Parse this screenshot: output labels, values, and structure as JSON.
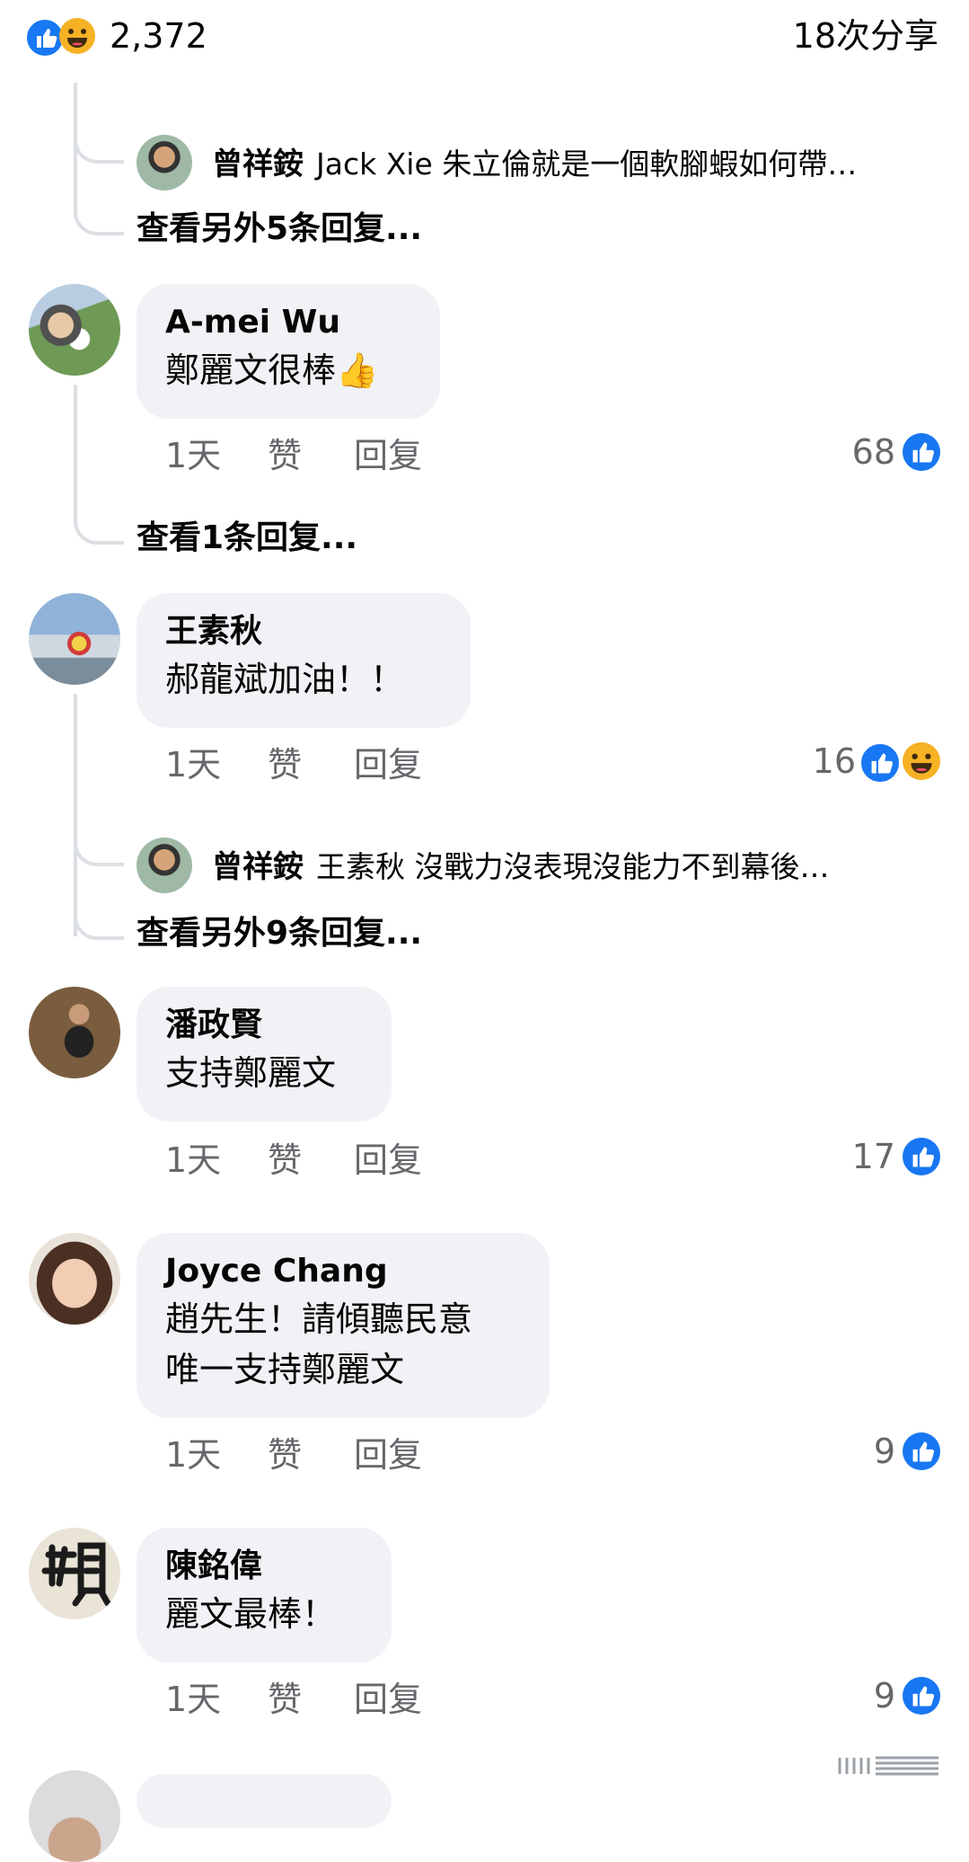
{
  "header": {
    "reaction_count": "2,372",
    "shares": "18次分享"
  },
  "colors": {
    "like_blue": "#1877f2",
    "haha_yellow": "#f7b125",
    "bubble_bg": "#f0f2f5",
    "meta_gray": "#65676b"
  },
  "thread0": {
    "reply_author": "曾祥銨",
    "reply_text": "Jack Xie 朱立倫就是一個軟腳蝦如何帶…",
    "more": "查看另外5条回复..."
  },
  "comments": [
    {
      "author": "A-mei Wu",
      "text": "鄭麗文很棒👍",
      "time": "1天",
      "like": "赞",
      "reply": "回复",
      "count": "68",
      "more": "查看1条回复..."
    },
    {
      "author": "王素秋",
      "text": "郝龍斌加油！！",
      "time": "1天",
      "like": "赞",
      "reply": "回复",
      "count": "16",
      "reply_author": "曾祥銨",
      "reply_text": "王素秋 沒戰力沒表現沒能力￼不到幕後…",
      "more": "查看另外9条回复..."
    },
    {
      "author": "潘政賢",
      "text": "支持鄭麗文",
      "time": "1天",
      "like": "赞",
      "reply": "回复",
      "count": "17"
    },
    {
      "author": "Joyce  Chang",
      "text1": "趙先生！請傾聽民意",
      "text2": "唯一支持鄭麗文",
      "time": "1天",
      "like": "赞",
      "reply": "回复",
      "count": "9"
    },
    {
      "author": "陳銘偉",
      "text": "麗文最棒！",
      "time": "1天",
      "like": "赞",
      "reply": "回复",
      "count": "9"
    }
  ],
  "icons": [
    "like-reaction-icon",
    "haha-reaction-icon",
    "menu-icon"
  ]
}
